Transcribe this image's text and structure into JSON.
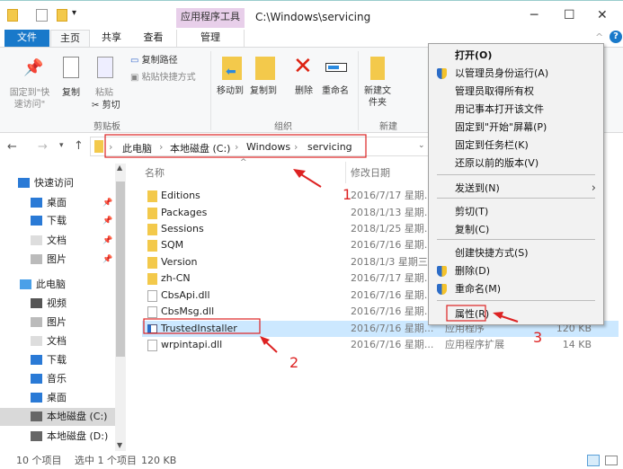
{
  "window": {
    "title": "C:\\Windows\\servicing",
    "contextual_tab_group": "应用程序工具",
    "help": "?"
  },
  "tabs": [
    {
      "label": "文件"
    },
    {
      "label": "主页"
    },
    {
      "label": "共享"
    },
    {
      "label": "查看"
    },
    {
      "label": "管理"
    }
  ],
  "ribbon": {
    "clipboard": {
      "pin": "固定到\"快速访问\"",
      "copy": "复制",
      "paste": "粘贴",
      "copy_path": "复制路径",
      "paste_shortcut": "粘贴快捷方式",
      "cut": "剪切",
      "group": "剪贴板"
    },
    "organize": {
      "move_to": "移动到",
      "copy_to": "复制到",
      "delete": "删除",
      "rename": "重命名",
      "group": "组织"
    },
    "new": {
      "new_folder": "新建文件夹",
      "group": "新建"
    }
  },
  "address": {
    "crumbs": [
      "此电脑",
      "本地磁盘 (C:)",
      "Windows",
      "servicing"
    ]
  },
  "nav": {
    "items": [
      {
        "label": "快速访问",
        "icon": "star-icon"
      },
      {
        "label": "桌面",
        "icon": "desktop-icon",
        "pinned": true
      },
      {
        "label": "下载",
        "icon": "download-icon",
        "pinned": true
      },
      {
        "label": "文档",
        "icon": "document-icon",
        "pinned": true
      },
      {
        "label": "图片",
        "icon": "picture-icon",
        "pinned": true
      },
      {
        "label": "此电脑",
        "icon": "computer-icon"
      },
      {
        "label": "视频",
        "icon": "video-icon"
      },
      {
        "label": "图片",
        "icon": "picture-icon"
      },
      {
        "label": "文档",
        "icon": "document-icon"
      },
      {
        "label": "下载",
        "icon": "download-icon"
      },
      {
        "label": "音乐",
        "icon": "music-icon"
      },
      {
        "label": "桌面",
        "icon": "desktop-icon"
      },
      {
        "label": "本地磁盘 (C:)",
        "icon": "drive-icon",
        "selected": true
      },
      {
        "label": "本地磁盘 (D:)",
        "icon": "drive-icon"
      }
    ]
  },
  "columns": {
    "name": "名称",
    "date": "修改日期"
  },
  "files": [
    {
      "name": "Editions",
      "date": "2016/7/17 星期...",
      "kind": "folder"
    },
    {
      "name": "Packages",
      "date": "2018/1/13 星期...",
      "kind": "folder"
    },
    {
      "name": "Sessions",
      "date": "2018/1/25 星期...",
      "kind": "folder"
    },
    {
      "name": "SQM",
      "date": "2016/7/16 星期...",
      "kind": "folder"
    },
    {
      "name": "Version",
      "date": "2018/1/3 星期三",
      "kind": "folder"
    },
    {
      "name": "zh-CN",
      "date": "2016/7/17 星期...",
      "kind": "folder"
    },
    {
      "name": "CbsApi.dll",
      "date": "2016/7/16 星期...",
      "kind": "dll"
    },
    {
      "name": "CbsMsg.dll",
      "date": "2016/7/16 星期...",
      "kind": "dll"
    },
    {
      "name": "TrustedInstaller",
      "date": "2016/7/16 星期...",
      "type": "应用程序",
      "size": "120 KB",
      "kind": "exe",
      "selected": true
    },
    {
      "name": "wrpintapi.dll",
      "date": "2016/7/16 星期...",
      "type": "应用程序扩展",
      "size": "14 KB",
      "kind": "dll"
    }
  ],
  "context_menu": [
    {
      "label": "打开(O)",
      "bold": true
    },
    {
      "label": "以管理员身份运行(A)",
      "shield": true
    },
    {
      "label": "管理员取得所有权"
    },
    {
      "label": "用记事本打开该文件"
    },
    {
      "label": "固定到\"开始\"屏幕(P)"
    },
    {
      "label": "固定到任务栏(K)"
    },
    {
      "label": "还原以前的版本(V)"
    },
    {
      "label": "发送到(N)",
      "submenu": true
    },
    {
      "label": "剪切(T)"
    },
    {
      "label": "复制(C)"
    },
    {
      "label": "创建快捷方式(S)"
    },
    {
      "label": "删除(D)",
      "shield": true
    },
    {
      "label": "重命名(M)",
      "shield": true
    },
    {
      "label": "属性(R)",
      "highlighted": true
    }
  ],
  "status": {
    "count": "10 个项目",
    "selected": "选中 1 个项目",
    "size": "120 KB"
  },
  "annotations": [
    "1",
    "2",
    "3"
  ],
  "colors": {
    "accent": "#1979ca",
    "selection": "#cce8ff",
    "annotation": "#d22222",
    "contextual": "#e8cfea"
  }
}
